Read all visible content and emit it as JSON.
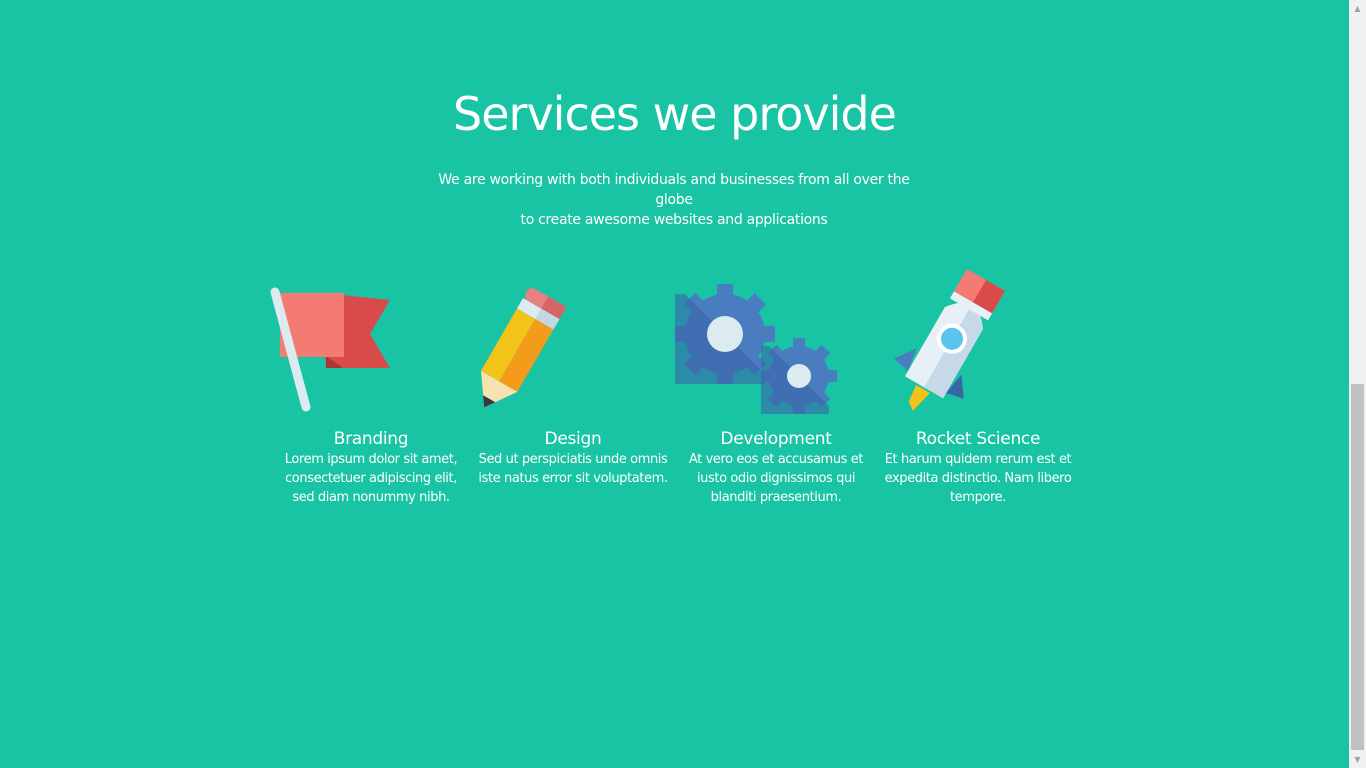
{
  "section": {
    "title": "Services we provide",
    "intro_line_1": "We are working with both individuals and businesses from all over the globe",
    "intro_line_2": "to create awesome websites and applications"
  },
  "services": [
    {
      "title": "Branding",
      "description": "Lorem ipsum dolor sit amet, consectetuer adipiscing elit, sed diam nonummy nibh.",
      "icon": "flag-icon"
    },
    {
      "title": "Design",
      "description": "Sed ut perspiciatis unde omnis iste natus error sit voluptatem.",
      "icon": "pencil-icon"
    },
    {
      "title": "Development",
      "description": "At vero eos et accusamus et iusto odio dignissimos qui blanditi praesentium.",
      "icon": "gears-icon"
    },
    {
      "title": "Rocket Science",
      "description": "Et harum quidem rerum est et expedita distinctio. Nam libero tempore.",
      "icon": "rocket-icon"
    }
  ],
  "colors": {
    "background": "#18c4a4",
    "text": "#ffffff",
    "flag_light": "#f47b73",
    "flag_dark": "#d94b4b",
    "pencil_yellow": "#f2c318",
    "pencil_orange": "#f39c1c",
    "gear_blue": "#4a7cc0",
    "gear_dark": "#3a66a8",
    "rocket_body": "#e8f0f7",
    "rocket_window": "#5ac4ec"
  }
}
